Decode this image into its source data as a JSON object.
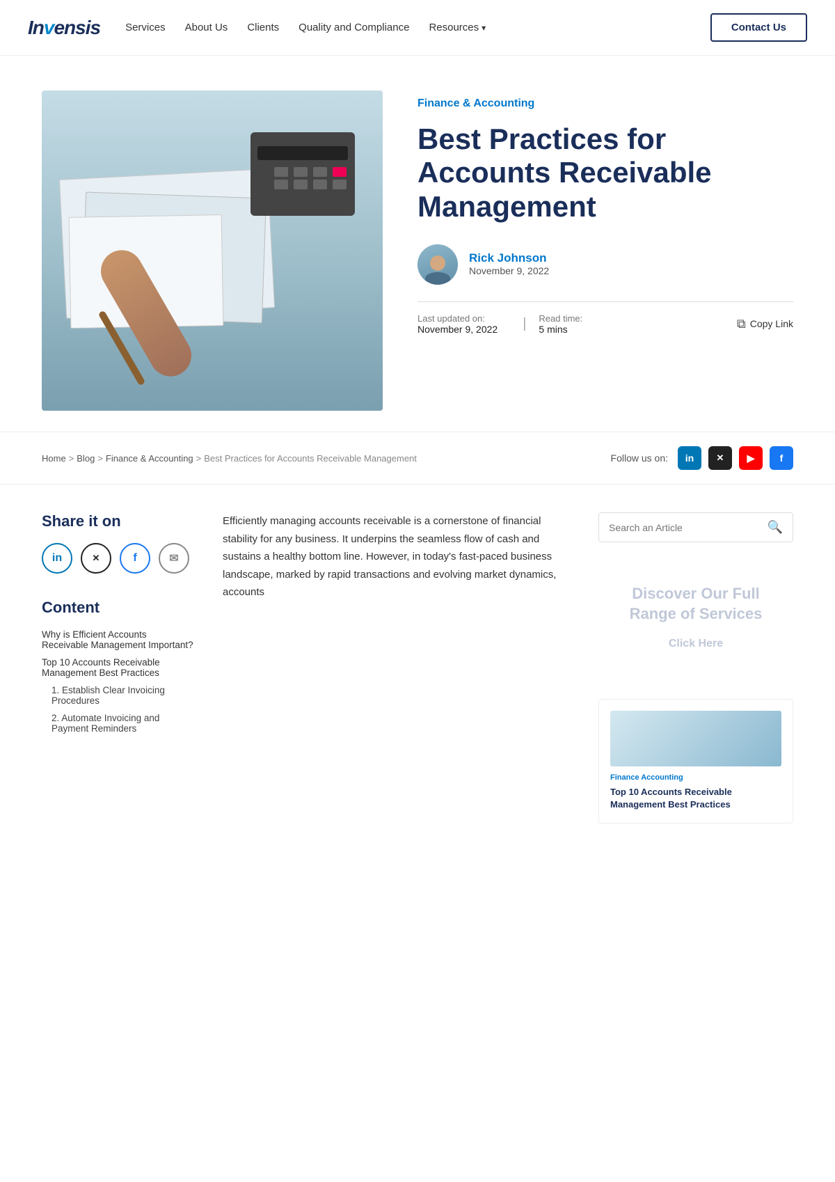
{
  "brand": {
    "logo": "Invensis",
    "logo_styled": "IN<span>V</span>ENSIS"
  },
  "nav": {
    "items": [
      {
        "label": "Services",
        "href": "#"
      },
      {
        "label": "About Us",
        "href": "#"
      },
      {
        "label": "Clients",
        "href": "#"
      },
      {
        "label": "Quality and Compliance",
        "href": "#"
      },
      {
        "label": "Resources",
        "href": "#",
        "has_dropdown": true
      },
      {
        "label": "Contact Us",
        "href": "#",
        "is_button": true
      }
    ]
  },
  "hero": {
    "category": "Finance & Accounting",
    "title": "Best Practices for Accounts Receivable Management",
    "author": {
      "name": "Rick Johnson",
      "date": "November 9, 2022"
    },
    "last_updated_label": "Last updated on:",
    "last_updated": "November 9, 2022",
    "read_time_label": "Read time:",
    "read_time": "5 mins",
    "copy_link_label": "Copy Link"
  },
  "breadcrumb": {
    "items": [
      {
        "label": "Home",
        "href": "#"
      },
      {
        "label": "Blog",
        "href": "#"
      },
      {
        "label": "Finance & Accounting",
        "href": "#"
      },
      {
        "label": "Best Practices for Accounts Receivable Management",
        "href": "#"
      }
    ],
    "separator": ">"
  },
  "follow": {
    "label": "Follow us on:",
    "networks": [
      {
        "name": "LinkedIn",
        "icon": "in"
      },
      {
        "name": "X (Twitter)",
        "icon": "✕"
      },
      {
        "name": "YouTube",
        "icon": "▶"
      },
      {
        "name": "Facebook",
        "icon": "f"
      }
    ]
  },
  "share": {
    "title": "Share it on",
    "networks": [
      {
        "name": "LinkedIn",
        "icon": "in"
      },
      {
        "name": "X (Twitter)",
        "icon": "✕"
      },
      {
        "name": "Facebook",
        "icon": "f"
      },
      {
        "name": "Email",
        "icon": "✉"
      }
    ]
  },
  "toc": {
    "title": "Content",
    "items": [
      {
        "label": "Why is Efficient Accounts Receivable Management Important?",
        "sub": false
      },
      {
        "label": "Top 10 Accounts Receivable Management Best Practices",
        "sub": false
      },
      {
        "label": "1. Establish Clear Invoicing Procedures",
        "sub": true
      },
      {
        "label": "2. Automate Invoicing and Payment Reminders",
        "sub": true
      }
    ]
  },
  "article": {
    "body": "Efficiently managing accounts receivable is a cornerstone of financial stability for any business. It underpins the seamless flow of cash and sustains a healthy bottom line. However, in today's fast-paced business landscape, marked by rapid transactions and evolving market dynamics, accounts"
  },
  "sidebar_right": {
    "search_placeholder": "Search an Article",
    "discover_title": "Discover Our Full Range of Services",
    "click_here": "Click Here"
  },
  "related": {
    "category": "Finance Accounting",
    "title": "Top 10 Accounts Receivable Management Best Practices"
  }
}
